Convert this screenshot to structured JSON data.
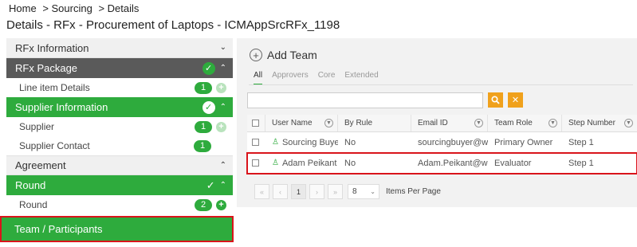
{
  "breadcrumb": [
    "Home",
    "> Sourcing",
    "> Details"
  ],
  "page_title": "Details - RFx - Procurement of Laptops - ICMAppSrcRFx_1198",
  "sidebar": {
    "rfx_information": "RFx Information",
    "rfx_package": "RFx Package",
    "line_item_details": "Line item Details",
    "line_item_count": "1",
    "supplier_information": "Supplier Information",
    "supplier": "Supplier",
    "supplier_count": "1",
    "supplier_contact": "Supplier Contact",
    "supplier_contact_count": "1",
    "agreement": "Agreement",
    "round": "Round",
    "round_sub": "Round",
    "round_count": "2",
    "team_participants": "Team / Participants"
  },
  "main": {
    "add_team": "Add Team",
    "tabs": [
      "All",
      "Approvers",
      "Core",
      "Extended"
    ],
    "active_tab": "All",
    "search_placeholder": "",
    "columns": [
      "User Name",
      "By Rule",
      "Email ID",
      "Team Role",
      "Step Number"
    ],
    "rows": [
      {
        "user": "Sourcing Buyer",
        "by_rule": "No",
        "email": "sourcingbuyer@w...",
        "role": "Primary Owner",
        "step": "Step 1"
      },
      {
        "user": "Adam Peikant",
        "by_rule": "No",
        "email": "Adam.Peikant@w...",
        "role": "Evaluator",
        "step": "Step 1"
      }
    ],
    "pager": {
      "page": "1",
      "per_page": "8",
      "per_page_label": "Items Per Page"
    }
  },
  "colors": {
    "accent_green": "#2eab3d",
    "highlight_red": "#d9141b",
    "dark_header": "#5a5a5a",
    "action_orange": "#f0a11c"
  },
  "icons": [
    "chevron-down-icon",
    "chevron-up-icon",
    "check-circle-icon",
    "check-icon",
    "plus-circle-icon",
    "add-circle-icon",
    "search-icon",
    "close-icon",
    "filter-icon",
    "user-icon",
    "first-page-icon",
    "prev-page-icon",
    "next-page-icon",
    "last-page-icon"
  ]
}
